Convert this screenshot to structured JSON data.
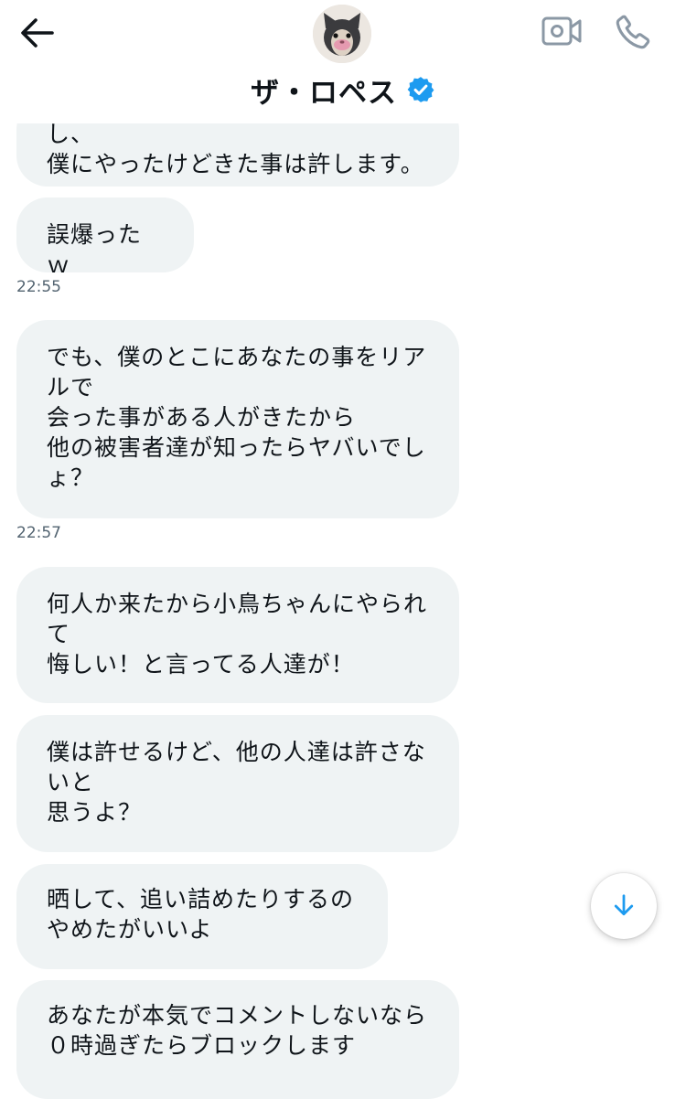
{
  "header": {
    "title": "ザ・ロペス",
    "back_icon": "back-arrow-icon",
    "video_icon": "video-call-icon",
    "call_icon": "phone-icon",
    "verified_color": "#1d9bf0"
  },
  "messages": [
    {
      "text": "し、\n僕にやったけどきた事は許します。"
    },
    {
      "text": "誤爆ったｗ"
    },
    {
      "text": "でも、僕のとこにあなたの事をリアルで\n会った事がある人がきたから\n他の被害者達が知ったらヤバいでしょ？"
    },
    {
      "text": "何人か来たから小鳥ちゃんにやられて\n悔しい！と言ってる人達が！"
    },
    {
      "text": "僕は許せるけど、他の人達は許さないと\n思うよ？"
    },
    {
      "text": "晒して、追い詰めたりするの\nやめたがいいよ"
    },
    {
      "text": "あなたが本気でコメントしないなら\n０時過ぎたらブロックします"
    }
  ],
  "timestamps": [
    "22:55",
    "22:57"
  ],
  "scroll_down_icon": "arrow-down-icon",
  "accent_color": "#1d9bf0"
}
